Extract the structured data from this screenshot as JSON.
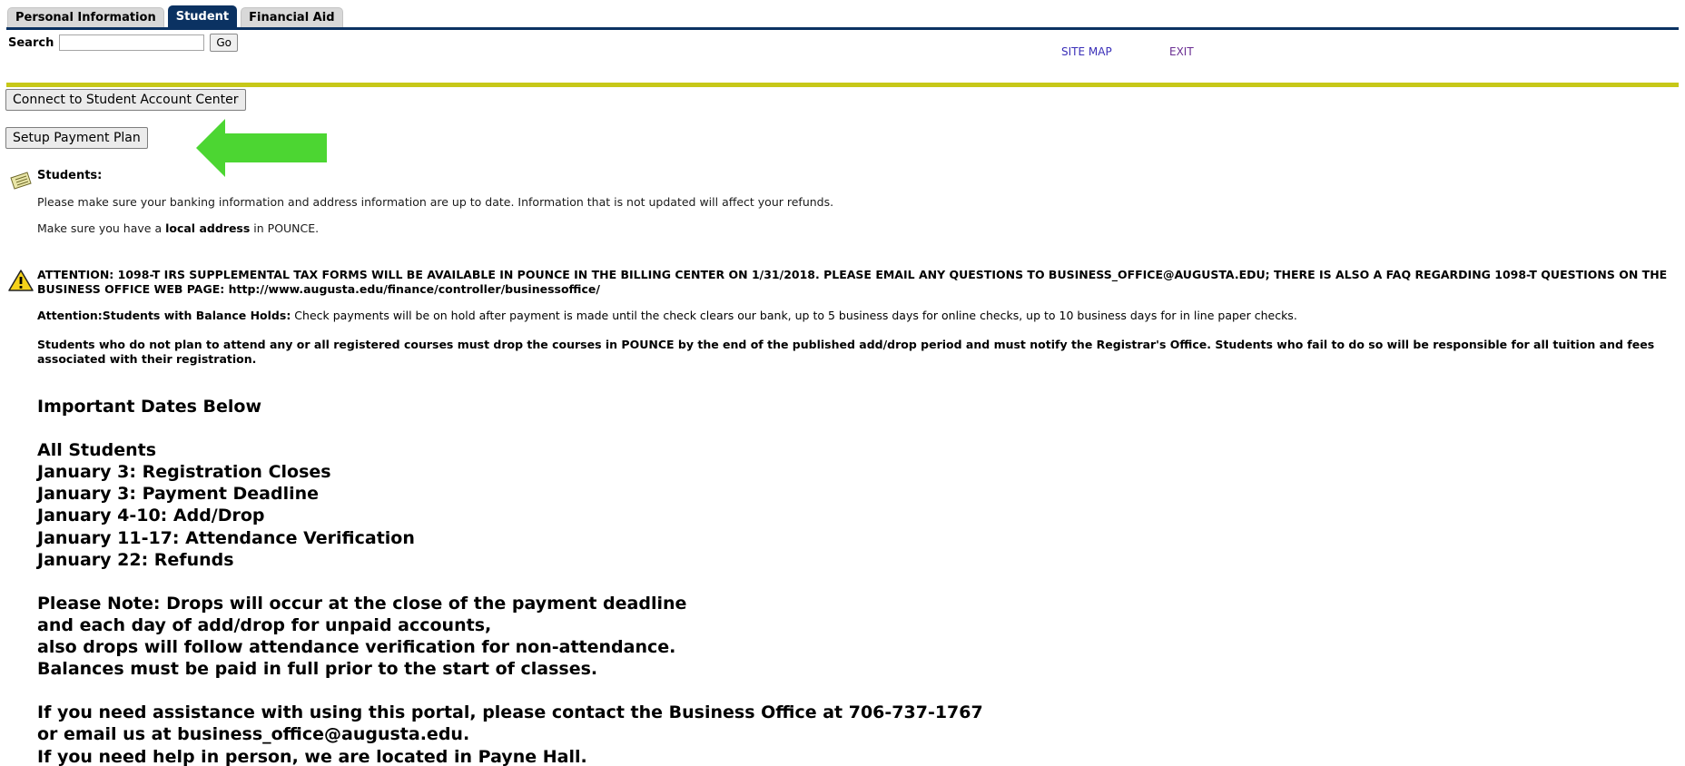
{
  "tabs": [
    {
      "label": "Personal Information",
      "active": false
    },
    {
      "label": "Student",
      "active": true
    },
    {
      "label": "Financial Aid",
      "active": false
    }
  ],
  "search": {
    "label": "Search",
    "value": "",
    "go_label": "Go"
  },
  "links": {
    "site_map": "SITE MAP",
    "exit": "EXIT"
  },
  "buttons": {
    "student_account_center": "Connect to Student Account Center",
    "setup_payment_plan": "Setup Payment Plan"
  },
  "info": {
    "heading": "Students:",
    "line1": "Please make sure your banking information and address information are up to date. Information that is not updated will affect your refunds.",
    "line2_prefix": "Make sure you have a ",
    "line2_bold": "local address",
    "line2_suffix": " in POUNCE."
  },
  "attention": {
    "tax_notice": "ATTENTION: 1098-T IRS SUPPLEMENTAL TAX FORMS WILL BE AVAILABLE IN POUNCE IN THE BILLING CENTER ON 1/31/2018. PLEASE EMAIL ANY QUESTIONS TO BUSINESS_OFFICE@AUGUSTA.EDU; THERE IS ALSO A FAQ REGARDING 1098-T QUESTIONS ON THE BUSINESS OFFICE WEB PAGE: http://www.augusta.edu/finance/controller/businessoffice/",
    "balance_holds_bold": "Attention:Students with Balance Holds:",
    "balance_holds_text": " Check payments will be on hold after payment is made until the check clears our bank, up to 5 business days for online checks, up to 10 business days for in line paper checks.",
    "drop_notice": "Students who do not plan to attend any or all registered courses must drop the courses in POUNCE by the end of the published add/drop period and must notify the Registrar's Office. Students who fail to do so will be responsible for all tuition and fees associated with their registration."
  },
  "important_dates": {
    "heading": "Important Dates Below",
    "group_heading": "All Students",
    "dates": [
      "January 3: Registration Closes",
      "January 3: Payment Deadline",
      "January 4-10: Add/Drop",
      "January 11-17: Attendance Verification",
      "January 22: Refunds"
    ],
    "note_lines": [
      "Please Note: Drops will occur at the close of the payment deadline",
      "and each day of add/drop for unpaid accounts,",
      "also drops will follow attendance verification for non-attendance.",
      "Balances must be paid in full prior to the start of classes."
    ],
    "contact_lines": [
      "If you need assistance with using this portal, please contact the Business Office at 706-737-1767",
      "or email us at business_office@augusta.edu.",
      "If you need help in person, we are located in Payne Hall."
    ]
  },
  "colors": {
    "tab_active_bg": "#0b3262",
    "accent_line": "#c7c818",
    "arrow": "#4cd632",
    "link": "#3a2fb8",
    "exit_link": "#6a2d92"
  },
  "icons": {
    "info": "info-note-icon",
    "warning": "warning-triangle-icon",
    "arrow": "green-left-arrow-icon"
  }
}
